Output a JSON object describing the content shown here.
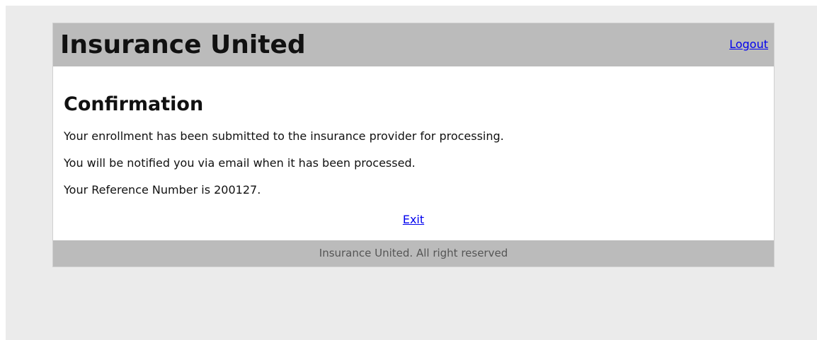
{
  "header": {
    "title": "Insurance United",
    "logout_label": "Logout"
  },
  "main": {
    "title": "Confirmation",
    "messages": [
      "Your enrollment has been submitted to the insurance provider for processing.",
      "You will be notified you via email when it has been processed.",
      "Your Reference Number is 200127."
    ],
    "exit_label": "Exit"
  },
  "footer": {
    "text": "Insurance United. All right reserved"
  },
  "colors": {
    "page_background": "#ebebeb",
    "bar_background": "#bbbbbb",
    "link": "#0000ee"
  }
}
